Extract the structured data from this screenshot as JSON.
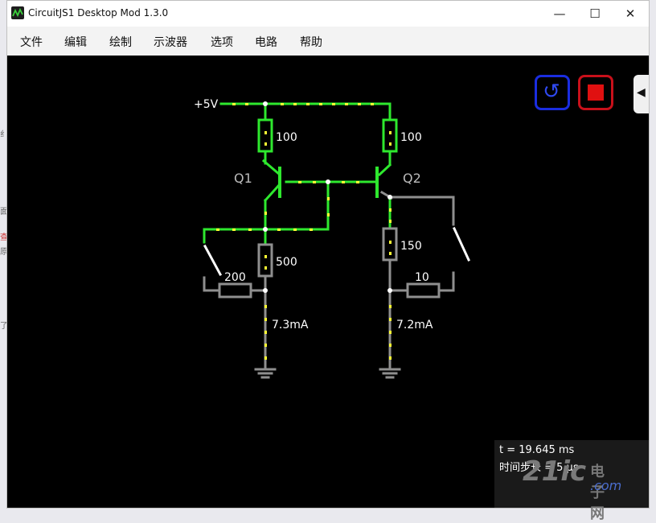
{
  "window": {
    "title": "CircuitJS1 Desktop Mod 1.3.0",
    "controls": {
      "minimize": "—",
      "maximize": "☐",
      "close": "✕"
    }
  },
  "menu": [
    "文件",
    "编辑",
    "绘制",
    "示波器",
    "选项",
    "电路",
    "帮助"
  ],
  "toolbar": {
    "reset_icon": "↺",
    "sidebar_arrow": "◀"
  },
  "circuit": {
    "supply": "+5V",
    "q1": "Q1",
    "q2": "Q2",
    "r_top_left": "100",
    "r_top_right": "100",
    "r_emitter_left": "500",
    "r_emitter_right": "150",
    "r_switch_left": "200",
    "r_switch_right": "10",
    "current_left": "7.3mA",
    "current_right": "7.2mA"
  },
  "status": {
    "time": "t = 19.645 ms",
    "timestep": "时间步长 = 5 μs"
  },
  "watermark": {
    "main": "21ic",
    "sub": "电子网",
    "domain": ".com"
  },
  "colors": {
    "wire_active": "#2ee82e",
    "wire_idle": "#8f8f8f",
    "current_dot": "#ffff33",
    "reset_border": "#1a2de0",
    "stop_fill": "#e01010"
  }
}
